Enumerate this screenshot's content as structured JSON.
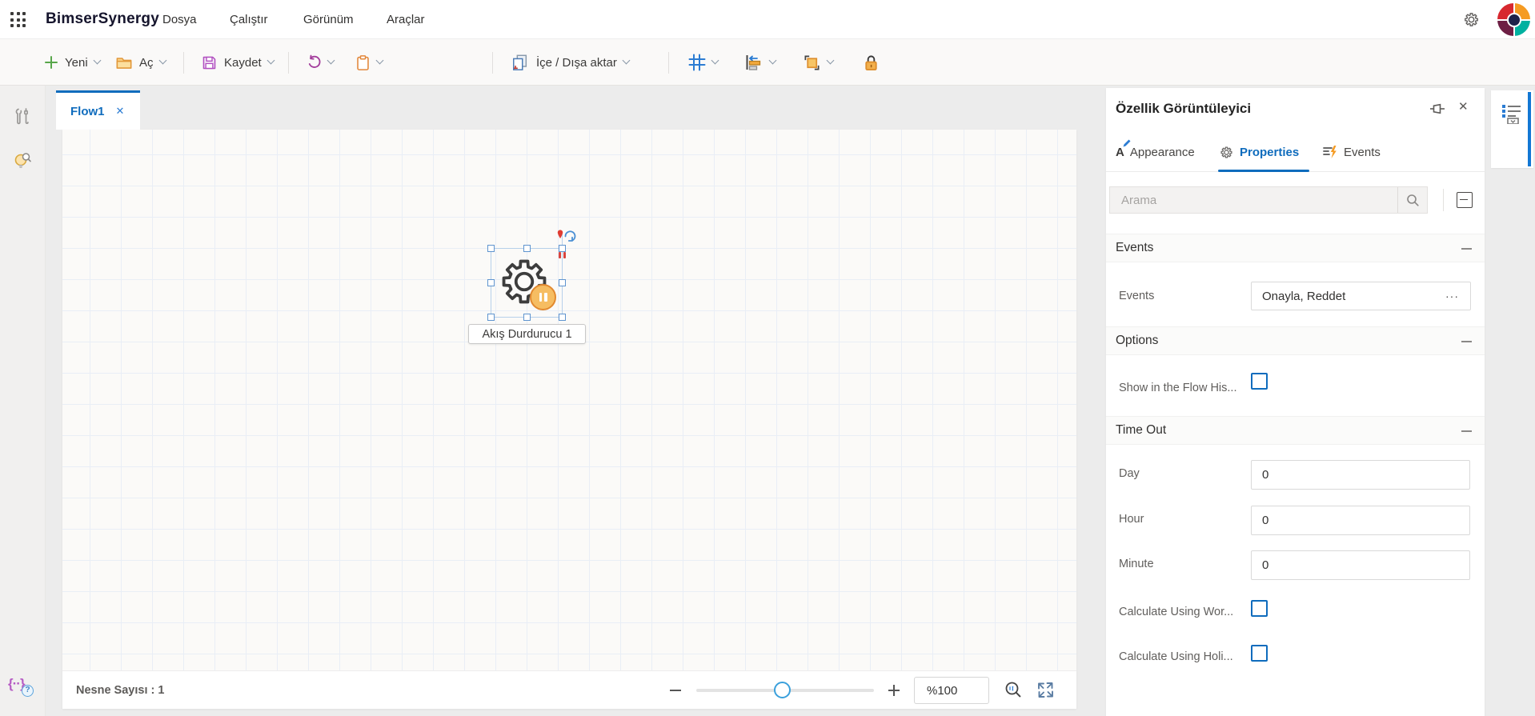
{
  "topbar": {
    "app_title": "BimserSynergy",
    "menus": [
      {
        "label": "Dosya"
      },
      {
        "label": "Çalıştır"
      },
      {
        "label": "Görünüm"
      },
      {
        "label": "Araçlar"
      }
    ]
  },
  "toolbar": {
    "new_label": "Yeni",
    "open_label": "Aç",
    "save_label": "Kaydet",
    "import_export_label": "İçe / Dışa aktar"
  },
  "tab": {
    "flow_label": "Flow1"
  },
  "canvas": {
    "node_label": "Akış Durdurucu 1"
  },
  "statusbar": {
    "object_count_label": "Nesne Sayısı : 1",
    "zoom_value": "%100"
  },
  "panel": {
    "title": "Özellik Görüntüleyici",
    "tab_appearance": "Appearance",
    "tab_properties": "Properties",
    "tab_events": "Events",
    "search_placeholder": "Arama",
    "events_section": {
      "title": "Events",
      "events_label": "Events",
      "events_value": "Onayla, Reddet"
    },
    "options_section": {
      "title": "Options",
      "show_history_label": "Show in the Flow His..."
    },
    "timeout_section": {
      "title": "Time Out",
      "day_label": "Day",
      "day_value": "0",
      "hour_label": "Hour",
      "hour_value": "0",
      "minute_label": "Minute",
      "minute_value": "0",
      "calc_workdays_label": "Calculate Using Wor...",
      "calc_holidays_label": "Calculate Using Holi..."
    }
  },
  "icons": {
    "close": "✕",
    "more": "···",
    "appearance_letter": "A",
    "braces": "{··}",
    "help_mark": "?"
  },
  "colors": {
    "accent_blue": "#0f6cbd",
    "toolbar_green": "#57a64a",
    "toolbar_orange": "#e8913a",
    "toolbar_purple": "#b14fc0",
    "grid_line": "#e9eef6",
    "selection_blue": "#5f94cf",
    "badge_orange": "#e2892f"
  }
}
